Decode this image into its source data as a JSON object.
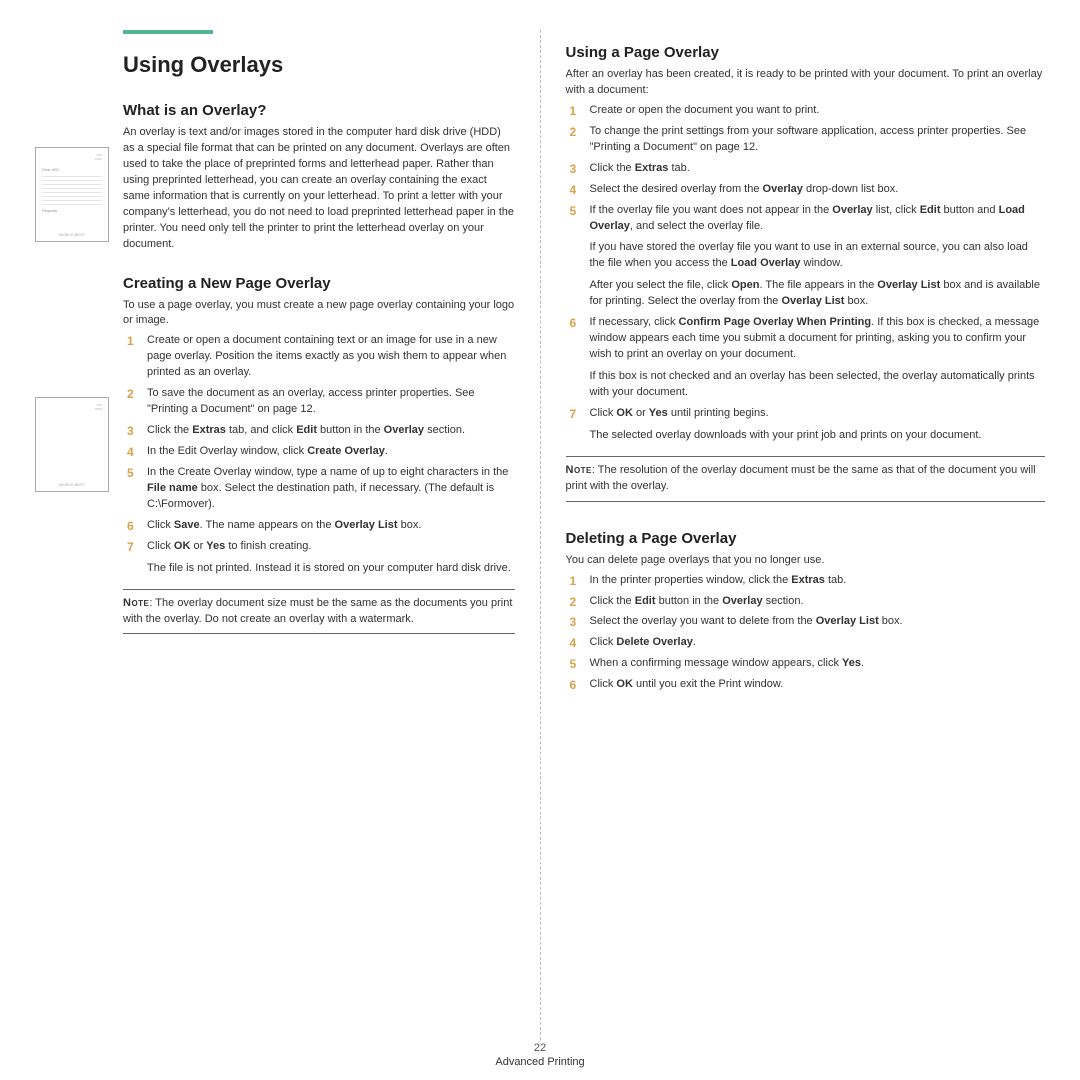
{
  "title": "Using Overlays",
  "left": {
    "s1": {
      "h": "What is an Overlay?",
      "p": "An overlay is text and/or images stored in the computer hard disk drive (HDD) as a special file format that can be printed on any document. Overlays are often used to take the place of preprinted forms and letterhead paper. Rather than using preprinted letterhead, you can create an overlay containing the exact same information that is currently on your letterhead. To print a letter with your company's letterhead, you do not need to load preprinted letterhead paper in the printer. You need only tell the printer to print the letterhead overlay on your document."
    },
    "s2": {
      "h": "Creating a New Page Overlay",
      "intro": "To use a page overlay, you must create a new page overlay containing your logo or image.",
      "steps": {
        "i1": "Create or open a document containing text or an image for use in a new page overlay. Position the items exactly as you wish them to appear when printed as an overlay.",
        "i2": "To save the document as an overlay, access printer properties. See \"Printing a Document\" on page 12.",
        "i3a": "Click the ",
        "i3b": "Extras",
        "i3c": " tab, and click ",
        "i3d": "Edit",
        "i3e": " button in the ",
        "i3f": "Overlay",
        "i3g": " section.",
        "i4a": "In the Edit Overlay window, click ",
        "i4b": "Create Overlay",
        "i4c": ".",
        "i5a": "In the Create Overlay window, type a name of up to eight characters in the ",
        "i5b": "File name",
        "i5c": " box. Select the destination path, if necessary. (The default is C:\\Formover).",
        "i6a": "Click ",
        "i6b": "Save",
        "i6c": ". The name appears on the ",
        "i6d": "Overlay List",
        "i6e": " box.",
        "i7a": "Click ",
        "i7b": "OK",
        "i7c": " or ",
        "i7d": "Yes",
        "i7e": " to finish creating.",
        "i7sub": "The file is not printed. Instead it is stored on your computer hard disk drive."
      },
      "note_label": "Note",
      "note": ": The overlay document size must be the same as the documents you print with the overlay. Do not create an overlay with a watermark."
    }
  },
  "right": {
    "s1": {
      "h": "Using a Page Overlay",
      "intro": "After an overlay has been created, it is ready to be printed with your document. To print an overlay with a document:",
      "steps": {
        "i1": "Create or open the document you want to print.",
        "i2": "To change the print settings from your software application, access printer properties. See \"Printing a Document\" on page 12.",
        "i3a": "Click the ",
        "i3b": "Extras",
        "i3c": " tab.",
        "i4a": "Select the desired overlay from the ",
        "i4b": "Overlay",
        "i4c": " drop-down list box.",
        "i5a": "If the overlay file you want does not appear in the ",
        "i5b": "Overlay",
        "i5c": " list, click ",
        "i5d": "Edit",
        "i5e": " button and ",
        "i5f": "Load Overlay",
        "i5g": ", and select the overlay file.",
        "i5s1a": "If you have stored the overlay file you want to use in an external source, you can also load the file when you access the ",
        "i5s1b": "Load Overlay",
        "i5s1c": " window.",
        "i5s2a": "After you select the file, click ",
        "i5s2b": "Open",
        "i5s2c": ". The file appears in the ",
        "i5s2d": "Overlay List",
        "i5s2e": " box and is available for printing. Select the overlay from the ",
        "i5s2f": "Overlay List",
        "i5s2g": " box.",
        "i6a": "If necessary, click ",
        "i6b": "Confirm Page Overlay When Printing",
        "i6c": ". If this box is checked, a message window appears each time you submit a document for printing, asking you to confirm your wish to print an overlay on your document.",
        "i6s1": "If this box is not checked and an overlay has been selected, the overlay automatically prints with your document.",
        "i7a": "Click ",
        "i7b": "OK",
        "i7c": " or ",
        "i7d": "Yes",
        "i7e": " until printing begins.",
        "i7s1": "The selected overlay downloads with your print job and prints on your document."
      },
      "note_label": "Note",
      "note": ": The resolution of the overlay document must be the same as that of the document you will print with the overlay."
    },
    "s2": {
      "h": "Deleting a Page Overlay",
      "intro": "You can delete page overlays that you no longer use.",
      "steps": {
        "i1a": "In the printer properties window, click the ",
        "i1b": "Extras",
        "i1c": " tab.",
        "i2a": "Click the ",
        "i2b": "Edit",
        "i2c": " button in the ",
        "i2d": "Overlay",
        "i2e": " section.",
        "i3a": "Select the overlay you want to delete from the ",
        "i3b": "Overlay List",
        "i3c": " box.",
        "i4a": "Click ",
        "i4b": "Delete Overlay",
        "i4c": ".",
        "i5a": "When a confirming message window appears, click ",
        "i5b": "Yes",
        "i5c": ".",
        "i6a": "Click ",
        "i6b": "OK",
        "i6c": " until you exit the Print window."
      }
    }
  },
  "footer": {
    "page": "22",
    "section": "Advanced Printing"
  },
  "thumb": {
    "dear": "Dear ABC",
    "regards": "Regards",
    "wb": "WORLD BEST"
  }
}
